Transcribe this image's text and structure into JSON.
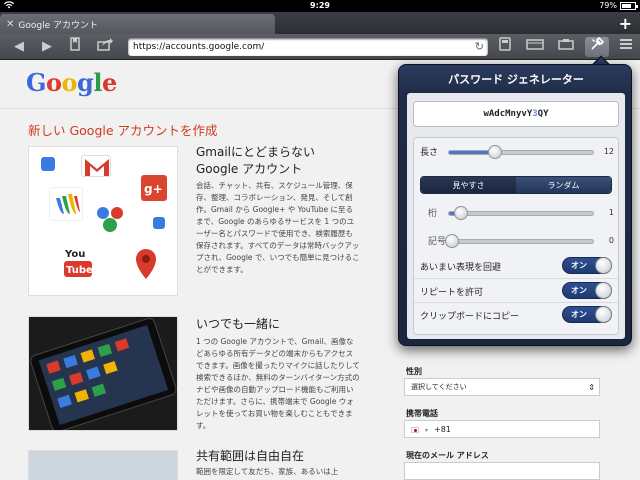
{
  "status_bar": {
    "time": "9:29",
    "battery": "79%",
    "battery_level": 0.79
  },
  "tab": {
    "title": "Google アカウント"
  },
  "toolbar": {
    "url": "https://accounts.google.com/"
  },
  "page": {
    "logo": "Google",
    "title": "新しい Google アカウントを作成",
    "features": [
      {
        "title_line1": "Gmailにとどまらない",
        "title_line2": "Google アカウント",
        "body": "会話、チャット、共有、スケジュール管理、保存、整理、コラボレーション、発見、そして創作。Gmail から Google+ や YouTube に至るまで、Google のあらゆるサービスを 1 つのユーザー名とパスワードで使用でき、検索履歴も保存されます。すべてのデータは常時バックアップされ、Google で、いつでも簡単に見つけることができます。"
      },
      {
        "title_line1": "いつでも一緒に",
        "title_line2": "",
        "body": "1 つの Google アカウントで、Gmail、画像などあらゆる所有データどの端末からもアクセスできます。画像を撮ったりマイクに話したりして検索できるほか、無料のターンバイターン方式のナビや画像の自動アップロード機能もご利用いただけます。さらに、携帯端末で Google ウォレットを使ってお買い物を楽しむこともできます。"
      },
      {
        "title_line1": "共有範囲は自由自在",
        "title_line2": "",
        "body": "範囲を限定して友だち、家族、あるいは上"
      }
    ],
    "form": {
      "gender_label": "性別",
      "gender_value": "選択してください",
      "phone_label": "携帯電話",
      "phone_value": "+81",
      "email_label": "現在のメール アドレス"
    }
  },
  "popover": {
    "title": "パスワード ジェネレーター",
    "password_prefix": "wAdcMnyvY",
    "password_highlight": "3",
    "password_suffix": "QY",
    "length_label": "長さ",
    "length_value": "12",
    "segments": [
      {
        "label": "見やすさ",
        "selected": false
      },
      {
        "label": "ランダム",
        "selected": true
      }
    ],
    "digits_label": "桁",
    "digits_value": "1",
    "symbols_label": "記号",
    "symbols_value": "0",
    "toggles": [
      {
        "label": "あいまい表現を回避",
        "state": "オン"
      },
      {
        "label": "リピートを許可",
        "state": "オン"
      },
      {
        "label": "クリップボードにコピー",
        "state": "オン"
      }
    ]
  },
  "colors": {
    "accent_red": "#d03a1f",
    "toggle_blue": "#2f4f93",
    "popover_navy": "#1f2c47"
  },
  "icons": [
    "wifi-icon",
    "battery-icon",
    "close-tab-icon",
    "new-tab-icon",
    "back-icon",
    "forward-icon",
    "bookmarks-icon",
    "share-icon",
    "reload-icon",
    "tools-icon",
    "menu-icon"
  ]
}
